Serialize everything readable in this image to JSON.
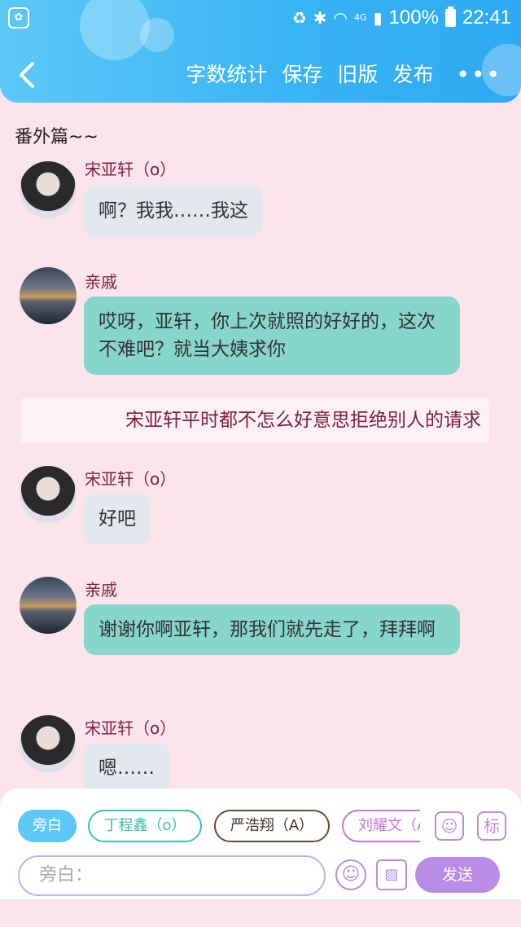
{
  "status_bar": {
    "battery": "100%",
    "time": "22:41",
    "network": "4G"
  },
  "nav": {
    "back_icon": "back-chevron-icon",
    "actions": [
      "字数统计",
      "保存",
      "旧版",
      "发布"
    ],
    "more": "•••"
  },
  "chat": {
    "title": "番外篇~~",
    "messages": [
      {
        "type": "dialog",
        "sender": "宋亚轩（o）",
        "text": "啊？我我……我这",
        "bubble": "grey",
        "avatar": "person"
      },
      {
        "type": "dialog",
        "sender": "亲戚",
        "text": "哎呀，亚轩，你上次就照的好好的，这次不难吧？就当大姨求你",
        "bubble": "teal",
        "avatar": "sunset"
      },
      {
        "type": "narration",
        "text": "宋亚轩平时都不怎么好意思拒绝别人的请求"
      },
      {
        "type": "dialog",
        "sender": "宋亚轩（o）",
        "text": "好吧",
        "bubble": "grey",
        "avatar": "person"
      },
      {
        "type": "dialog",
        "sender": "亲戚",
        "text": "谢谢你啊亚轩，那我们就先走了，拜拜啊",
        "bubble": "teal",
        "avatar": "sunset"
      },
      {
        "type": "dialog",
        "sender": "宋亚轩（o）",
        "text": "嗯……",
        "bubble": "grey",
        "avatar": "person"
      }
    ]
  },
  "panel": {
    "chips": [
      {
        "label": "旁白",
        "active": true,
        "color": "#5cc8f7"
      },
      {
        "label": "丁程鑫（o）",
        "active": false,
        "color": "#3bbfb0"
      },
      {
        "label": "严浩翔（A）",
        "active": false,
        "color": "#6b4a3a"
      },
      {
        "label": "刘耀文（A",
        "active": false,
        "color": "#c774d6"
      }
    ],
    "role_icon": "person-card-icon",
    "tag_label": "标",
    "input_placeholder": "旁白：",
    "emoji_icon": "smiley-icon",
    "image_icon": "image-icon",
    "send_label": "发送"
  },
  "colors": {
    "header": "#39b4f4",
    "background": "#fbe4ea",
    "sender_text": "#7c1f44",
    "grey_bubble": "#e3e7ee",
    "teal_bubble": "#86d6cc",
    "accent_purple": "#b98ce6"
  }
}
